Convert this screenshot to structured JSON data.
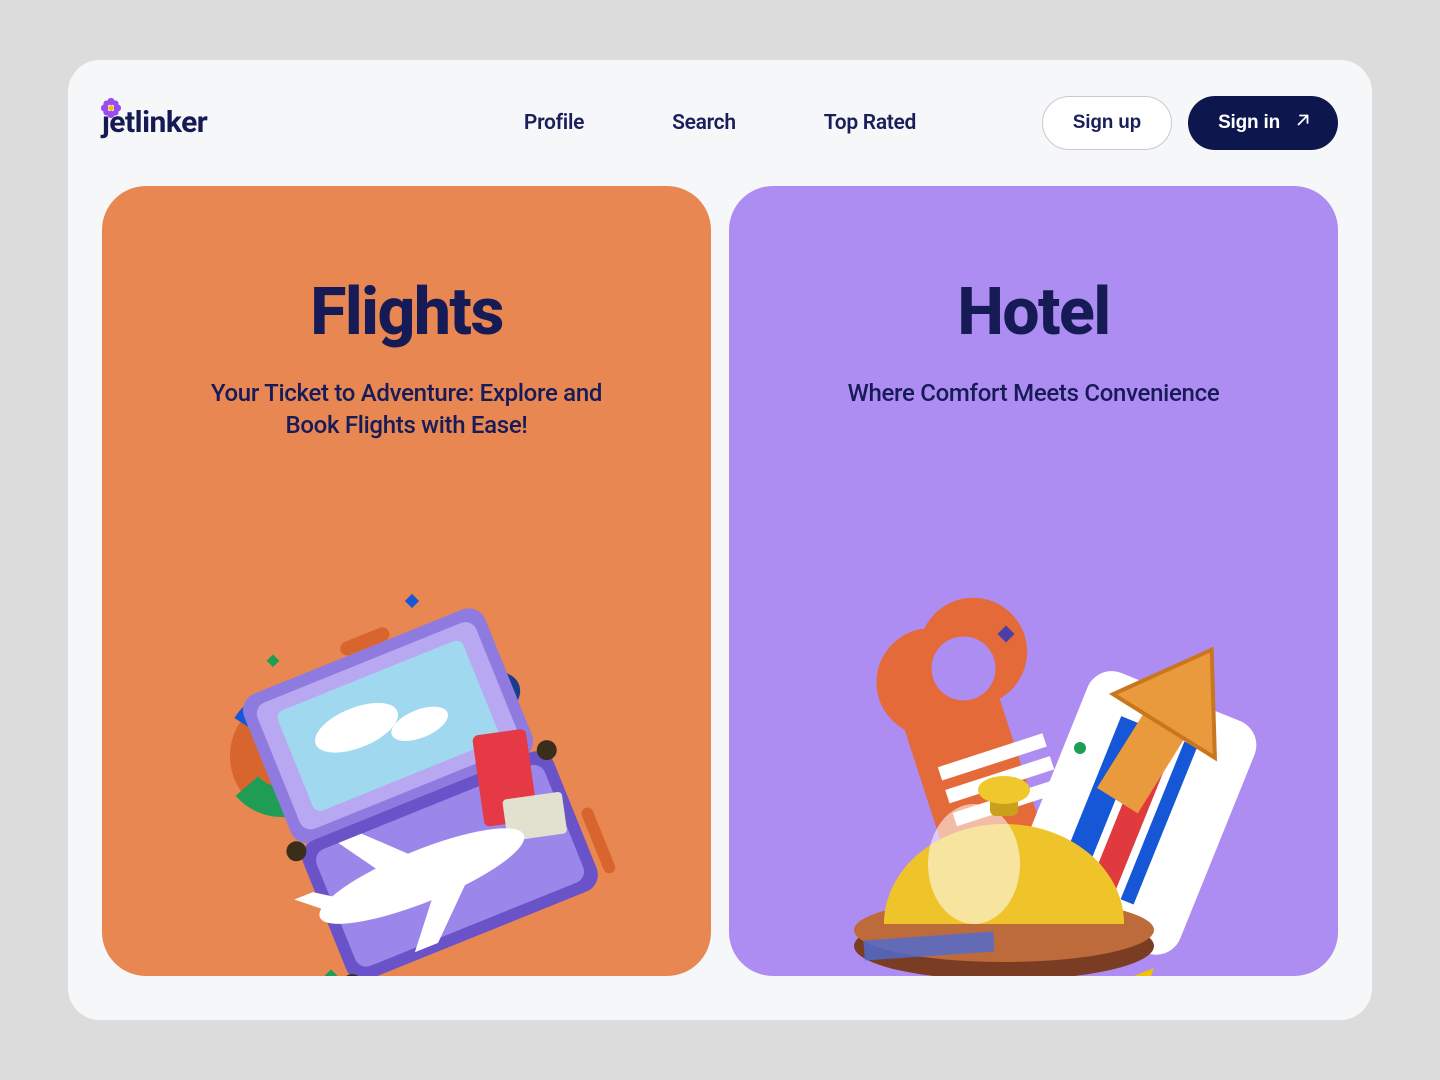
{
  "brand": {
    "name": "jetlinker"
  },
  "nav": {
    "items": [
      {
        "label": "Profile"
      },
      {
        "label": "Search"
      },
      {
        "label": "Top Rated"
      }
    ]
  },
  "auth": {
    "signup_label": "Sign up",
    "signin_label": "Sign in"
  },
  "cards": {
    "flights": {
      "title": "Flights",
      "subtitle": "Your Ticket to Adventure: Explore and Book Flights with Ease!"
    },
    "hotel": {
      "title": "Hotel",
      "subtitle": "Where Comfort Meets Convenience"
    }
  },
  "colors": {
    "brand_navy": "#0d174e",
    "text_navy": "#161a55",
    "card_orange": "#e98752",
    "card_lilac": "#ae8df2",
    "flower_purple": "#9a4cf0"
  }
}
